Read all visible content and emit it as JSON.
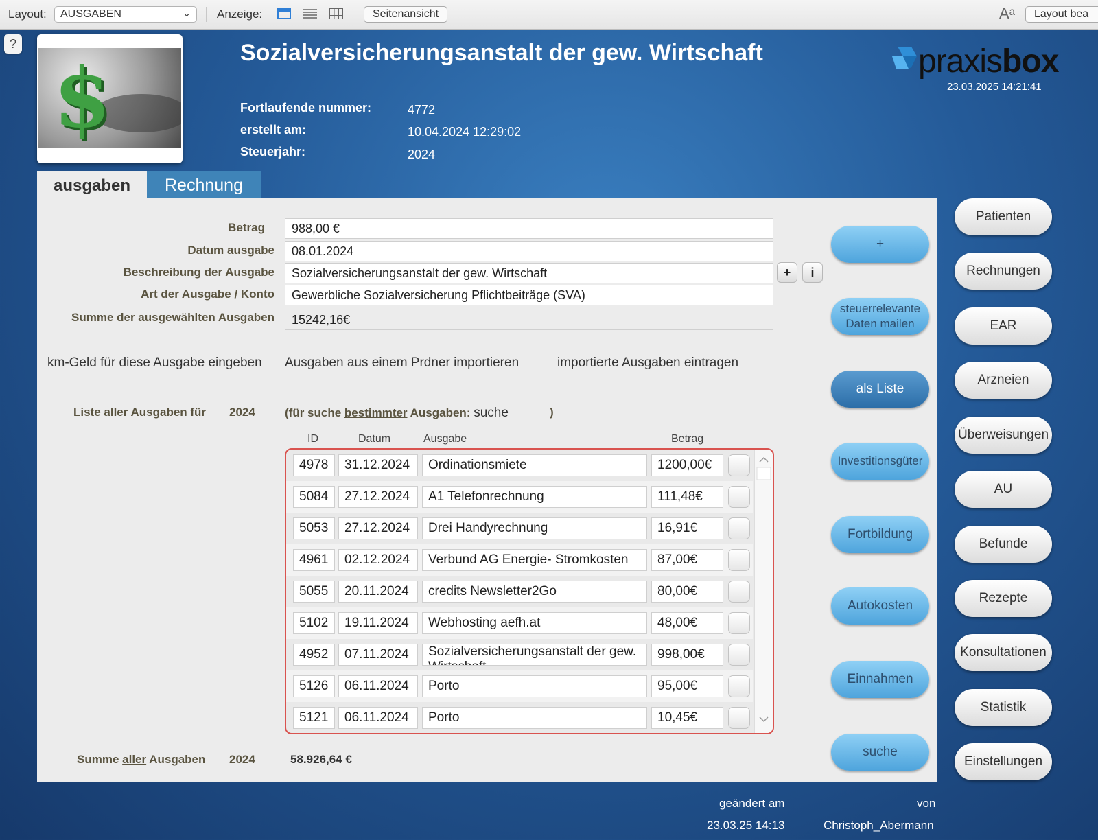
{
  "toolbar": {
    "layout_label": "Layout:",
    "layout_value": "AUSGABEN",
    "anzeige_label": "Anzeige:",
    "seitenansicht": "Seitenansicht",
    "font_glyph": "Aᵃ",
    "layout_edit": "Layout bea"
  },
  "help": "?",
  "header": {
    "title": "Sozialversicherungsanstalt der gew. Wirtschaft",
    "brand_light": "praxis",
    "brand_bold": "box",
    "datetime": "23.03.2025  14:21:41",
    "meta": [
      {
        "label": "Fortlaufende nummer:",
        "value": "4772"
      },
      {
        "label": "erstellt am:",
        "value": "10.04.2024 12:29:02"
      },
      {
        "label": "Steuerjahr:",
        "value": "2024"
      }
    ]
  },
  "tabs": {
    "active": "ausgaben",
    "other": "Rechnung"
  },
  "form": {
    "betrag_label": "Betrag",
    "betrag": "988,00 €",
    "datum_label": "Datum ausgabe",
    "datum": "08.01.2024",
    "beschreibung_label": "Beschreibung der Ausgabe",
    "beschreibung": "Sozialversicherungsanstalt der gew. Wirtschaft",
    "art_label": "Art der Ausgabe / Konto",
    "art": "Gewerbliche Sozialversicherung Pflichtbeiträge (SVA)",
    "summe_label": "Summe der ausgewählten Ausgaben",
    "summe": "15242,16€",
    "plus": "+",
    "info": "i"
  },
  "links": {
    "km": "km-Geld für diese Ausgabe eingeben",
    "import": "Ausgaben aus einem Prdner importieren",
    "eintragen": "importierte Ausgaben eintragen"
  },
  "list": {
    "pre": "Liste ",
    "aller": "aller",
    "post": " Ausgaben für",
    "year": "2024",
    "search_pre": "(für suche ",
    "bestimmter": "bestimmter",
    "search_mid": " Ausgaben: ",
    "suche": "suche",
    "search_close": ")",
    "col_id": "ID",
    "col_datum": "Datum",
    "col_ausgabe": "Ausgabe",
    "col_betrag": "Betrag",
    "rows": [
      {
        "id": "4978",
        "datum": "31.12.2024",
        "ausgabe": "Ordinationsmiete",
        "betrag": "1200,00€"
      },
      {
        "id": "5084",
        "datum": "27.12.2024",
        "ausgabe": "A1 Telefonrechnung",
        "betrag": "111,48€"
      },
      {
        "id": "5053",
        "datum": "27.12.2024",
        "ausgabe": "Drei Handyrechnung",
        "betrag": "16,91€"
      },
      {
        "id": "4961",
        "datum": "02.12.2024",
        "ausgabe": "Verbund AG Energie- Stromkosten",
        "betrag": "87,00€"
      },
      {
        "id": "5055",
        "datum": "20.11.2024",
        "ausgabe": "credits Newsletter2Go",
        "betrag": "80,00€"
      },
      {
        "id": "5102",
        "datum": "19.11.2024",
        "ausgabe": "Webhosting aefh.at",
        "betrag": "48,00€"
      },
      {
        "id": "4952",
        "datum": "07.11.2024",
        "ausgabe": "Sozialversicherungsanstalt der gew. Wirtschaft",
        "betrag": "998,00€"
      },
      {
        "id": "5126",
        "datum": "06.11.2024",
        "ausgabe": "Porto",
        "betrag": "95,00€"
      },
      {
        "id": "5121",
        "datum": "06.11.2024",
        "ausgabe": "Porto",
        "betrag": "10,45€"
      }
    ],
    "sum_pre": "Summe ",
    "sum_aller": "aller",
    "sum_post": " Ausgaben",
    "sum_year": "2024",
    "sum_value": "58.926,64 €"
  },
  "actions": {
    "add": "+",
    "mail_1": "steuerrelevante",
    "mail_2": "Daten mailen",
    "liste": "als Liste",
    "invest": "Investitionsgüter",
    "fortbildung": "Fortbildung",
    "auto": "Autokosten",
    "einnahmen": "Einnahmen",
    "suche": "suche"
  },
  "nav": [
    "Patienten",
    "Rechnungen",
    "EAR",
    "Arzneien",
    "Überweisungen",
    "AU",
    "Befunde",
    "Rezepte",
    "Konsultationen",
    "Statistik",
    "Einstellungen"
  ],
  "footer": {
    "geaendert_label": "geändert am",
    "von_label": "von",
    "geaendert": "23.03.25 14:13",
    "von": "Christoph_Abermann"
  },
  "colors": {
    "accent_blue": "#4ea4dc",
    "alert_red": "#d9534f",
    "brand_blue": "#2f8fd8"
  }
}
